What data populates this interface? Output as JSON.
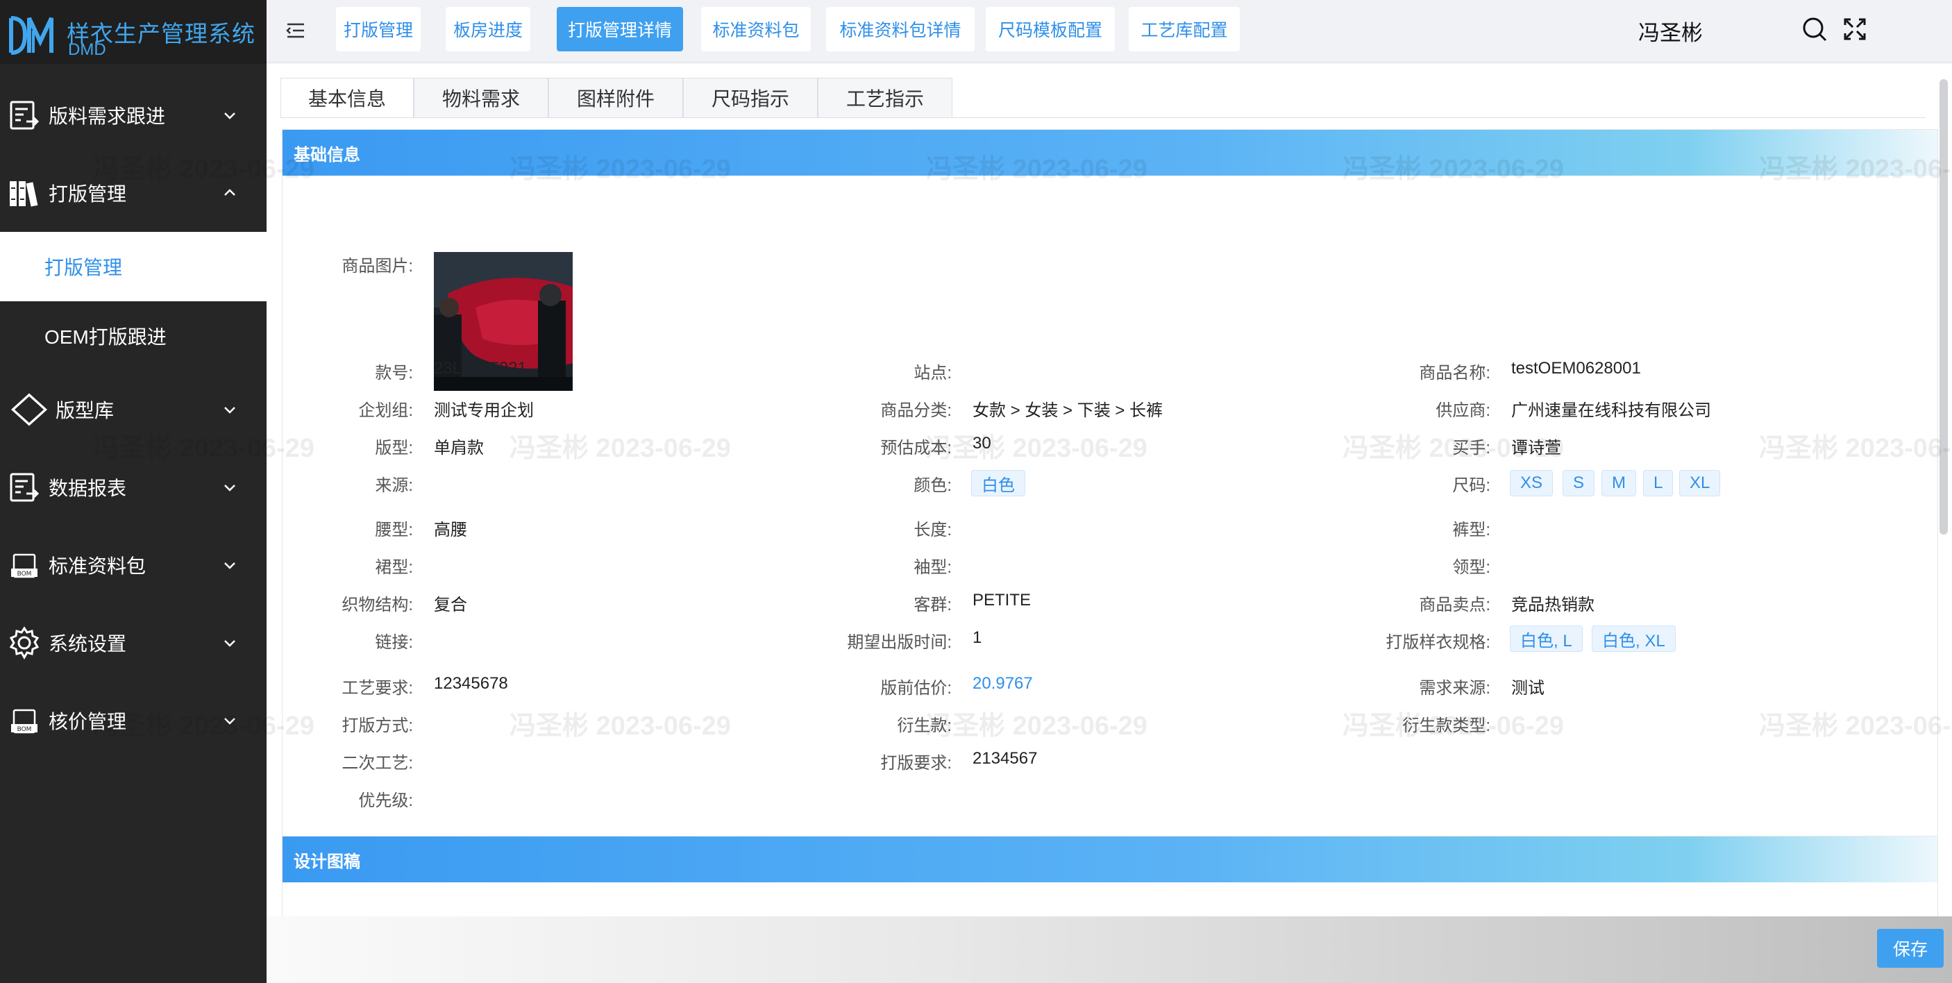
{
  "app": {
    "title": "样衣生产管理系统",
    "subtitle": "DMD"
  },
  "sidebar": {
    "items": [
      {
        "label": "版料需求跟进",
        "icon": "flowchart-icon"
      },
      {
        "label": "打版管理",
        "icon": "books-icon"
      },
      {
        "label": "版型库",
        "icon": "diamond-icon"
      },
      {
        "label": "数据报表",
        "icon": "flowchart-icon"
      },
      {
        "label": "标准资料包",
        "icon": "bom-icon"
      },
      {
        "label": "系统设置",
        "icon": "gear-icon"
      },
      {
        "label": "核价管理",
        "icon": "bom-icon"
      }
    ],
    "sub_items": [
      {
        "label": "打版管理",
        "active": true
      },
      {
        "label": "OEM打版跟进",
        "active": false
      }
    ]
  },
  "header": {
    "tabs": [
      "打版管理",
      "板房进度",
      "打版管理详情",
      "标准资料包",
      "标准资料包详情",
      "尺码模板配置",
      "工艺库配置"
    ],
    "active_tab": "打版管理详情",
    "user": "冯圣彬"
  },
  "inner_tabs": [
    "基本信息",
    "物料需求",
    "图样附件",
    "尺码指示",
    "工艺指示"
  ],
  "basic_info": {
    "section_title": "基础信息",
    "image_label": "商品图片:",
    "fields": {
      "style_no": {
        "label": "款号:",
        "value": "23L11AT021"
      },
      "site": {
        "label": "站点:",
        "value": ""
      },
      "product_name": {
        "label": "商品名称:",
        "value": "testOEM0628001"
      },
      "planning_group": {
        "label": "企划组:",
        "value": "测试专用企划"
      },
      "category": {
        "label": "商品分类:",
        "value": "女款 > 女装 > 下装 > 长裤"
      },
      "supplier": {
        "label": "供应商:",
        "value": "广州速量在线科技有限公司"
      },
      "pattern": {
        "label": "版型:",
        "value": "单肩款"
      },
      "est_cost": {
        "label": "预估成本:",
        "value": "30"
      },
      "buyer": {
        "label": "买手:",
        "value": "谭诗萱"
      },
      "source": {
        "label": "来源:",
        "value": ""
      },
      "color": {
        "label": "颜色:",
        "chips": [
          "白色"
        ]
      },
      "size": {
        "label": "尺码:",
        "chips": [
          "XS",
          "S",
          "M",
          "L",
          "XL"
        ]
      },
      "waist": {
        "label": "腰型:",
        "value": "高腰"
      },
      "length": {
        "label": "长度:",
        "value": ""
      },
      "pants_type": {
        "label": "裤型:",
        "value": ""
      },
      "skirt_type": {
        "label": "裙型:",
        "value": ""
      },
      "sleeve_type": {
        "label": "袖型:",
        "value": ""
      },
      "collar_type": {
        "label": "领型:",
        "value": ""
      },
      "fabric": {
        "label": "织物结构:",
        "value": "复合"
      },
      "customer_group": {
        "label": "客群:",
        "value": "PETITE"
      },
      "selling_point": {
        "label": "商品卖点:",
        "value": "竞品热销款"
      },
      "link": {
        "label": "链接:",
        "value": ""
      },
      "expected_time": {
        "label": "期望出版时间:",
        "value": "1"
      },
      "sample_spec": {
        "label": "打版样衣规格:",
        "chips": [
          "白色, L",
          "白色, XL"
        ]
      },
      "craft_req": {
        "label": "工艺要求:",
        "value": "12345678"
      },
      "pre_price": {
        "label": "版前估价:",
        "value": "20.9767"
      },
      "demand_source": {
        "label": "需求来源:",
        "value": "测试"
      },
      "pattern_method": {
        "label": "打版方式:",
        "value": ""
      },
      "derivative": {
        "label": "衍生款:",
        "value": ""
      },
      "derivative_type": {
        "label": "衍生款类型:",
        "value": ""
      },
      "secondary_craft": {
        "label": "二次工艺:",
        "value": ""
      },
      "pattern_req": {
        "label": "打版要求:",
        "value": "2134567"
      },
      "priority": {
        "label": "优先级:",
        "value": ""
      }
    }
  },
  "design_section": {
    "title": "设计图稿"
  },
  "watermark": "冯圣彬 2023-06-29",
  "footer": {
    "save_label": "保存"
  },
  "colors": {
    "primary": "#3fa0f0",
    "sidebar_bg": "#262626",
    "active_text": "#2f8fe8"
  }
}
